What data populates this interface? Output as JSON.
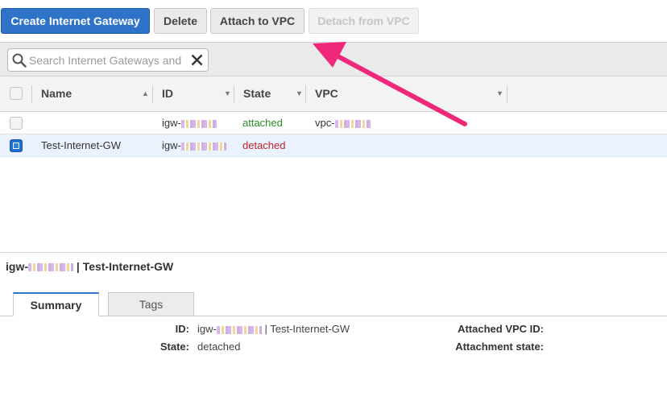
{
  "toolbar": {
    "create_label": "Create Internet Gateway",
    "delete_label": "Delete",
    "attach_label": "Attach to VPC",
    "detach_label": "Detach from VPC"
  },
  "search": {
    "placeholder": "Search Internet Gateways and"
  },
  "table": {
    "columns": [
      "Name",
      "ID",
      "State",
      "VPC"
    ],
    "rows": [
      {
        "name": "",
        "id": "igw-",
        "state": "attached",
        "vpc": "vpc-"
      },
      {
        "name": "Test-Internet-GW",
        "id": "igw-",
        "state": "detached",
        "vpc": ""
      }
    ]
  },
  "detail": {
    "title_prefix": "igw-",
    "title_suffix": " | Test-Internet-GW",
    "tabs": [
      "Summary",
      "Tags"
    ],
    "id_label": "ID:",
    "id_prefix": "igw-",
    "id_suffix": " | Test-Internet-GW",
    "state_label": "State:",
    "state_value": "detached",
    "attached_vpc_label": "Attached VPC ID:",
    "attachment_state_label": "Attachment state:"
  },
  "colors": {
    "primary": "#2f73c8",
    "state_attached": "#2a8b2a",
    "state_detached": "#c0232b",
    "annotation_arrow": "#f0287a"
  }
}
